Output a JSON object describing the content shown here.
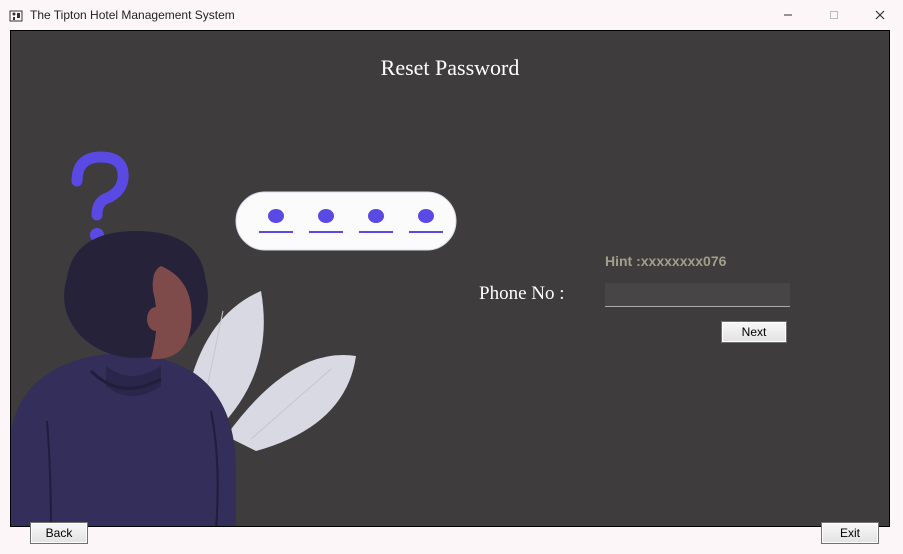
{
  "window": {
    "title": "The Tipton Hotel Management System"
  },
  "page": {
    "title": "Reset Password"
  },
  "form": {
    "hint_label": "Hint :xxxxxxxx076",
    "phone_label": "Phone No :",
    "phone_value": "",
    "next_label": "Next"
  },
  "footer": {
    "back_label": "Back",
    "exit_label": "Exit"
  }
}
